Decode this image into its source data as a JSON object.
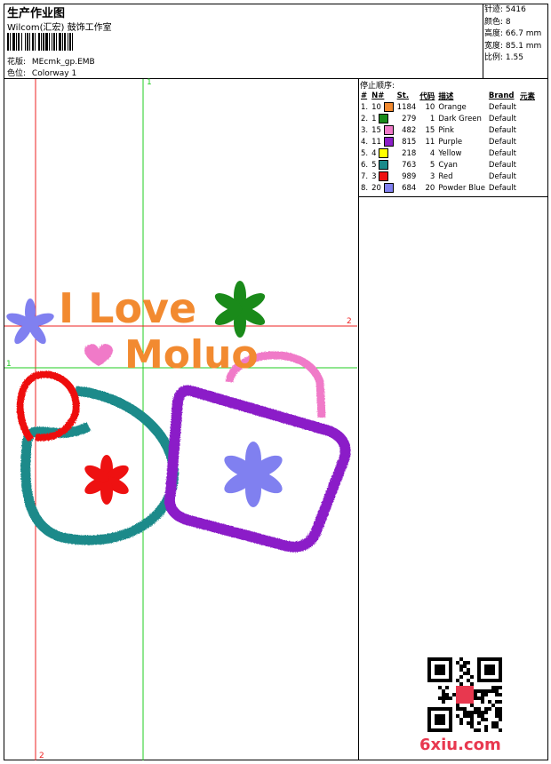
{
  "header": {
    "title": "生产作业图",
    "company": "Wilcom(汇宏) 鼓饰工作室",
    "design_label": "花版:",
    "design_value": "MEcmk_gp.EMB",
    "colorway_label": "色位:",
    "colorway_value": "Colorway 1"
  },
  "stats": {
    "stitches": "针迹: 5416",
    "colors": "颜色: 8",
    "height": "高度: 66.7 mm",
    "width": "宽度: 85.1 mm",
    "scale": "比例: 1.55"
  },
  "stop_sequence_title": "停止顺序:",
  "table": {
    "headers": [
      "#",
      "N#",
      "St.",
      "代码",
      "描述",
      "Brand",
      "元素"
    ],
    "rows": [
      {
        "idx": "1.",
        "n": "10",
        "color": "#f28a30",
        "st": "1184",
        "code": "10",
        "desc": "Orange",
        "brand": "Default"
      },
      {
        "idx": "2.",
        "n": "1",
        "color": "#1a8a1a",
        "st": "279",
        "code": "1",
        "desc": "Dark Green",
        "brand": "Default"
      },
      {
        "idx": "3.",
        "n": "15",
        "color": "#f07ac8",
        "st": "482",
        "code": "15",
        "desc": "Pink",
        "brand": "Default"
      },
      {
        "idx": "4.",
        "n": "11",
        "color": "#8b1fc8",
        "st": "815",
        "code": "11",
        "desc": "Purple",
        "brand": "Default"
      },
      {
        "idx": "5.",
        "n": "4",
        "color": "#ffff00",
        "st": "218",
        "code": "4",
        "desc": "Yellow",
        "brand": "Default"
      },
      {
        "idx": "6.",
        "n": "5",
        "color": "#1a8a8a",
        "st": "763",
        "code": "5",
        "desc": "Cyan",
        "brand": "Default"
      },
      {
        "idx": "7.",
        "n": "3",
        "color": "#ee1111",
        "st": "989",
        "code": "3",
        "desc": "Red",
        "brand": "Default"
      },
      {
        "idx": "8.",
        "n": "20",
        "color": "#8080f0",
        "st": "684",
        "code": "20",
        "desc": "Powder Blue",
        "brand": "Default"
      }
    ]
  },
  "guides": {
    "v1_label": "1",
    "h2_label": "2",
    "h1_label": "1",
    "v2_label": "2"
  },
  "design": {
    "line1": "I Love",
    "line2": "Moluo"
  },
  "watermark": "6xiu.com"
}
